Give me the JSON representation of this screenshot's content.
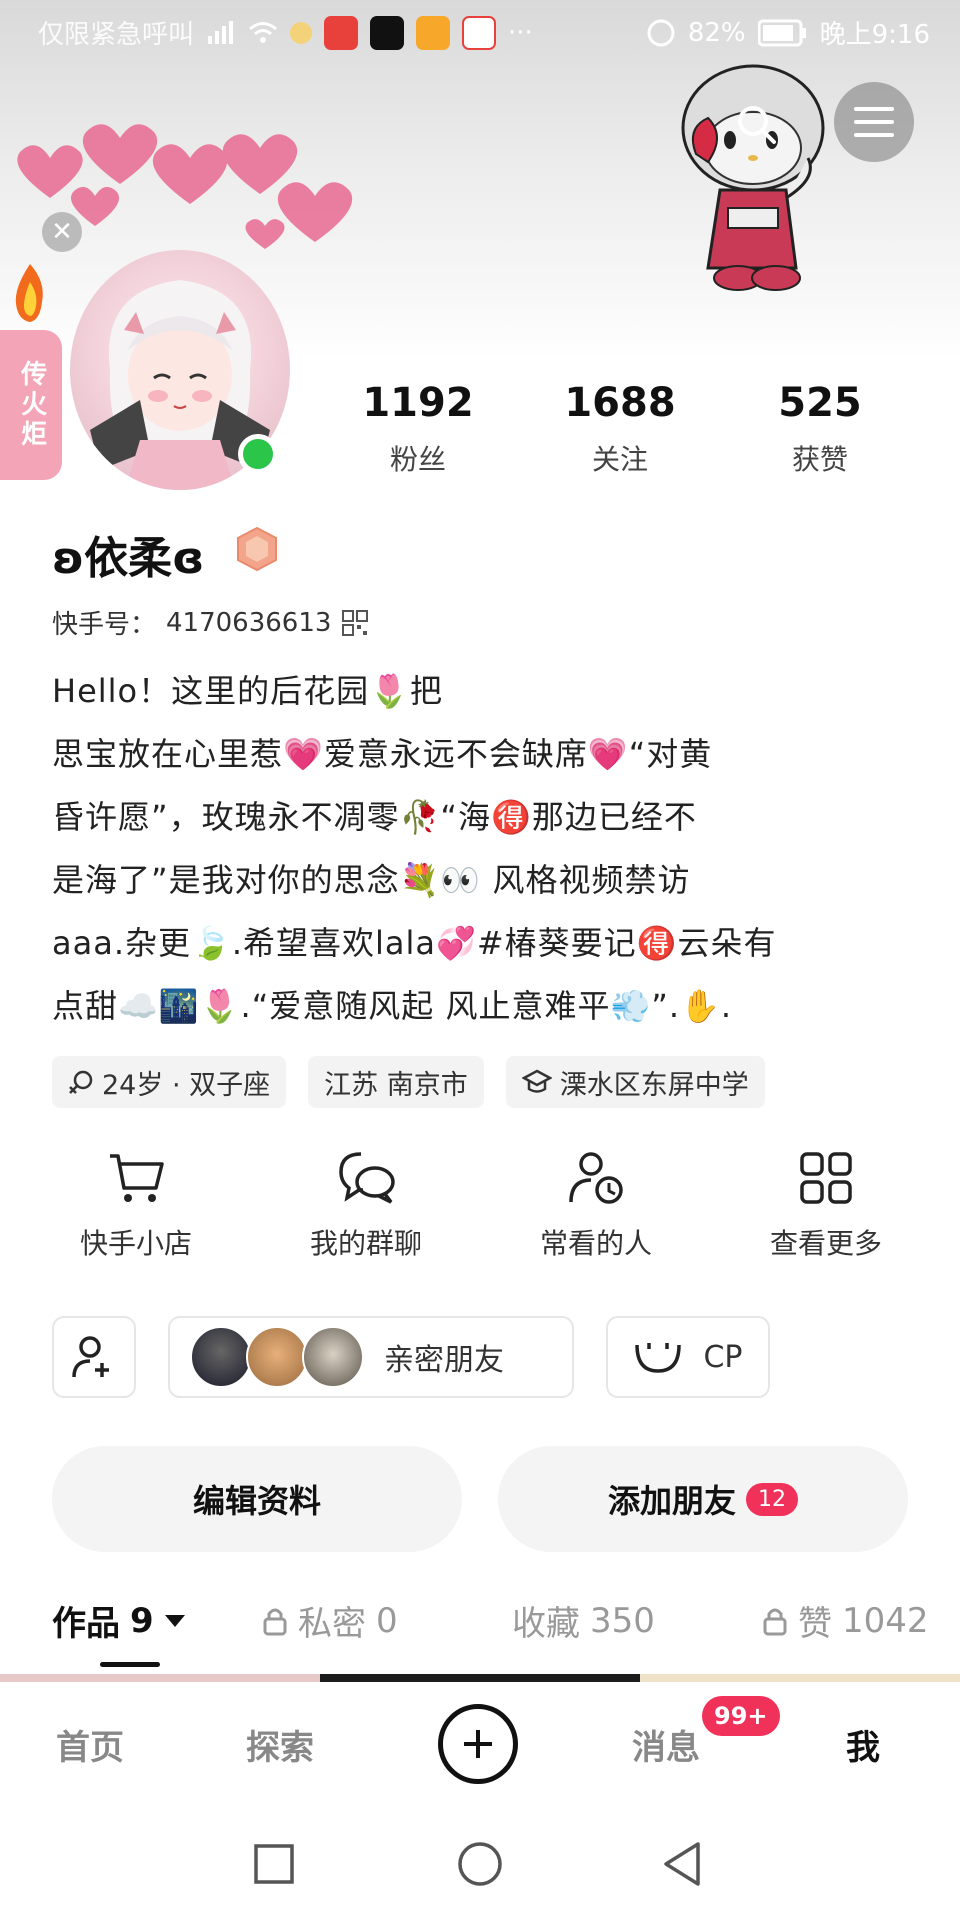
{
  "status_bar": {
    "left_text": "仅限紧急呼叫",
    "battery": "82%",
    "time": "晚上9:16",
    "more": "···"
  },
  "torch_tab": {
    "label": "传火炬"
  },
  "stats": [
    {
      "value": "1192",
      "label": "粉丝"
    },
    {
      "value": "1688",
      "label": "关注"
    },
    {
      "value": "525",
      "label": "获赞"
    }
  ],
  "profile": {
    "username": "ʚ依柔ɞ",
    "id_label": "快手号：",
    "id_value": "4170636613",
    "bio_lines": [
      "Hello！这里的后花园🌷把",
      "思宝放在心里惹💗爱意永远不会缺席💗“对黄",
      "昏许愿”，玫瑰永不凋零🥀“海🉐那边已经不",
      "是海了”是我对你的思念💐👀 风格视频禁访",
      "aaa.杂更🍃.希望喜欢lala💞#椿葵要记🉐云朵有",
      "点甜☁️🌃🌷.“爱意随风起 风止意难平💨”.✋."
    ]
  },
  "tags": [
    {
      "icon": "gender-icon",
      "text": "24岁 · 双子座"
    },
    {
      "icon": "",
      "text": "江苏 南京市"
    },
    {
      "icon": "school-icon",
      "text": "溧水区东屏中学"
    }
  ],
  "quick_actions": [
    {
      "icon": "cart-icon",
      "label": "快手小店"
    },
    {
      "icon": "group-chat-icon",
      "label": "我的群聊"
    },
    {
      "icon": "frequent-people-icon",
      "label": "常看的人"
    },
    {
      "icon": "grid-icon",
      "label": "查看更多"
    }
  ],
  "friends_row": {
    "close_friends_label": "亲密朋友",
    "cp_label": "CP"
  },
  "buttons": {
    "edit_profile": "编辑资料",
    "add_friends": "添加朋友",
    "add_friends_count": "12"
  },
  "content_tabs": [
    {
      "label": "作品",
      "count": "9",
      "active": true
    },
    {
      "label": "私密",
      "count": "0",
      "locked": true
    },
    {
      "label": "收藏",
      "count": "350"
    },
    {
      "label": "赞",
      "count": "1042",
      "locked": true
    }
  ],
  "bottom_nav": {
    "home": "首页",
    "explore": "探索",
    "messages": "消息",
    "messages_badge": "99+",
    "me": "我"
  },
  "colors": {
    "accent_red": "#f0315a",
    "online_green": "#2bc54a",
    "torch_pink": "#f3a4b6"
  }
}
